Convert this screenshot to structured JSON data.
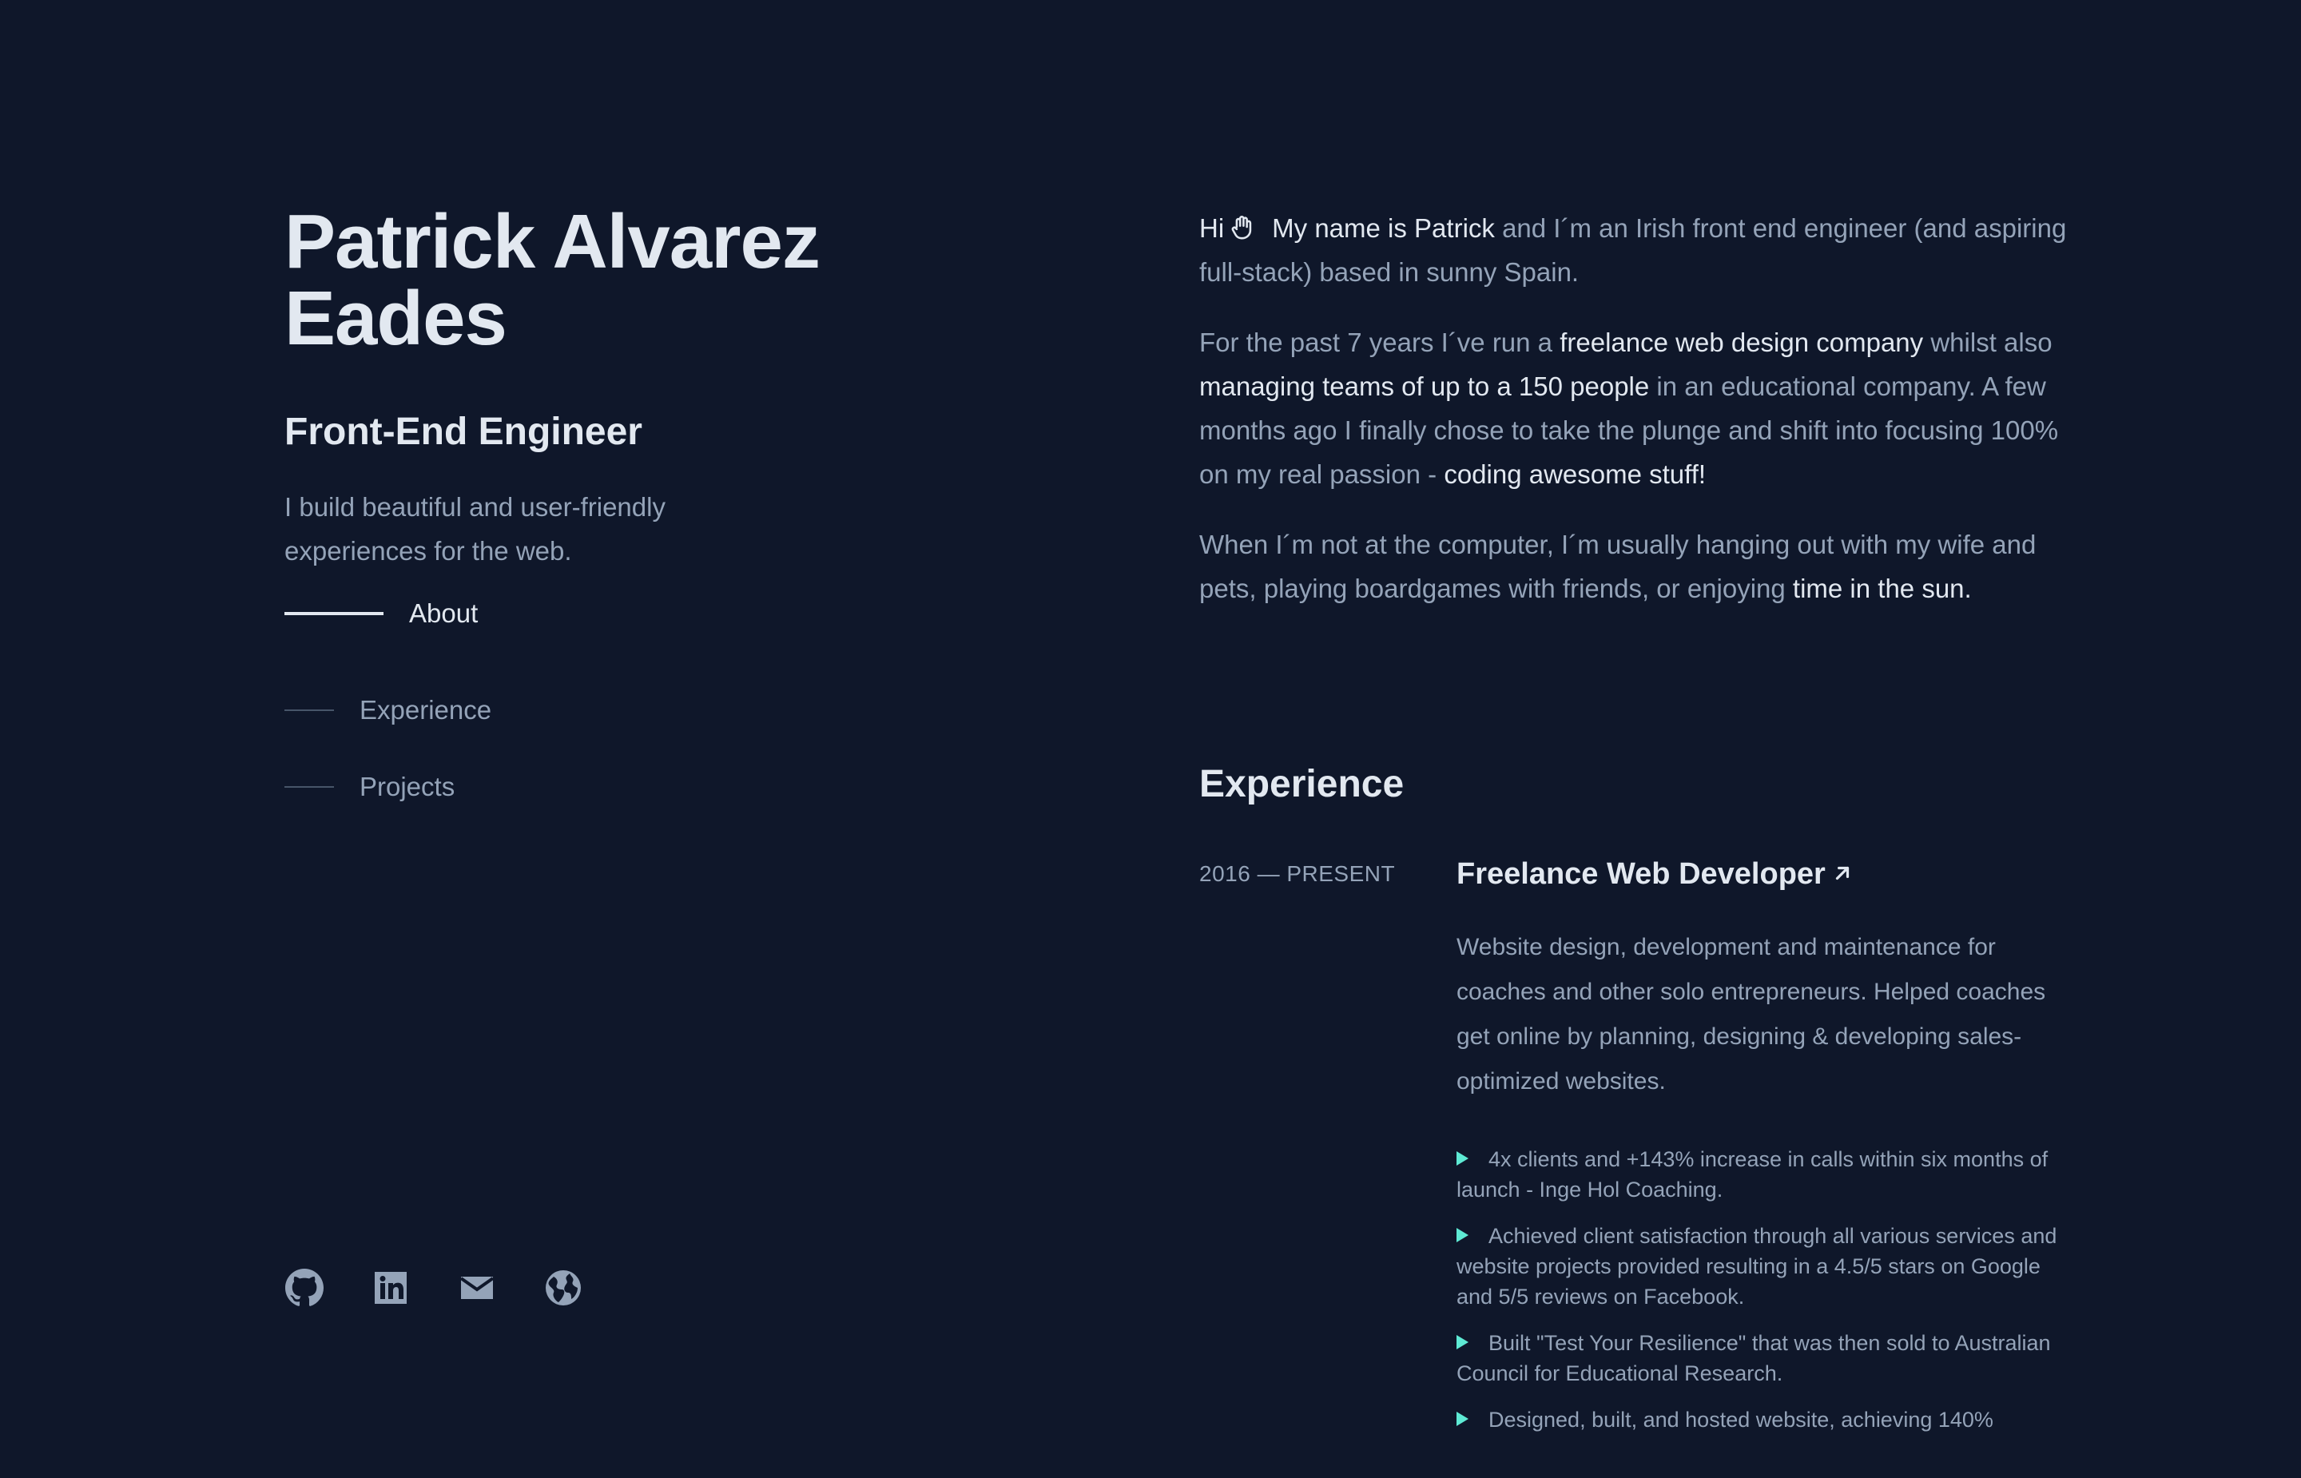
{
  "profile": {
    "name_line1": "Patrick Alvarez",
    "name_line2": "Eades",
    "role": "Front-End Engineer",
    "tagline": "I build beautiful and user-friendly experiences for the web."
  },
  "nav": {
    "items": [
      {
        "label": "About",
        "active": true
      },
      {
        "label": "Experience",
        "active": false
      },
      {
        "label": "Projects",
        "active": false
      }
    ]
  },
  "socials": [
    {
      "icon": "github-icon"
    },
    {
      "icon": "linkedin-icon"
    },
    {
      "icon": "email-icon"
    },
    {
      "icon": "globe-icon"
    }
  ],
  "about": {
    "p1": {
      "hi": "Hi",
      "name_highlight": "My name is Patrick",
      "rest": " and I´m an Irish front end engineer (and aspiring full-stack) based in sunny Spain."
    },
    "p2": {
      "t1": "For the past 7 years I´ve run a ",
      "h1": "freelance web design company",
      "t2": " whilst also ",
      "h2": "managing teams of up to a 150 people",
      "t3": " in an educational company. A few months ago I finally chose to take the plunge and shift into focusing 100% on my real passion - ",
      "h3": "coding awesome stuff!"
    },
    "p3": {
      "t1": "When I´m not at the computer, I´m usually hanging out with my wife and pets, playing boardgames with friends, or enjoying ",
      "h1": "time in the sun."
    }
  },
  "experience": {
    "section_title": "Experience",
    "jobs": [
      {
        "date": "2016 — PRESENT",
        "title": "Freelance Web Developer",
        "description": "Website design, development and maintenance for coaches and other solo entrepreneurs. Helped coaches get online by planning, designing & developing sales-optimized websites.",
        "bullets": [
          "4x clients and +143% increase in calls within six months of launch - Inge Hol Coaching.",
          "Achieved client satisfaction through all various services and website projects provided resulting in a 4.5/5 stars on Google and 5/5 reviews on Facebook.",
          "Built \"Test Your Resilience\" that was then sold to Australian Council for Educational Research.",
          "Designed, built, and hosted website, achieving 140%"
        ]
      }
    ]
  },
  "colors": {
    "background": "#0f172a",
    "heading": "#e2e8f0",
    "body": "#94a3b8",
    "accent": "#5eead4"
  }
}
